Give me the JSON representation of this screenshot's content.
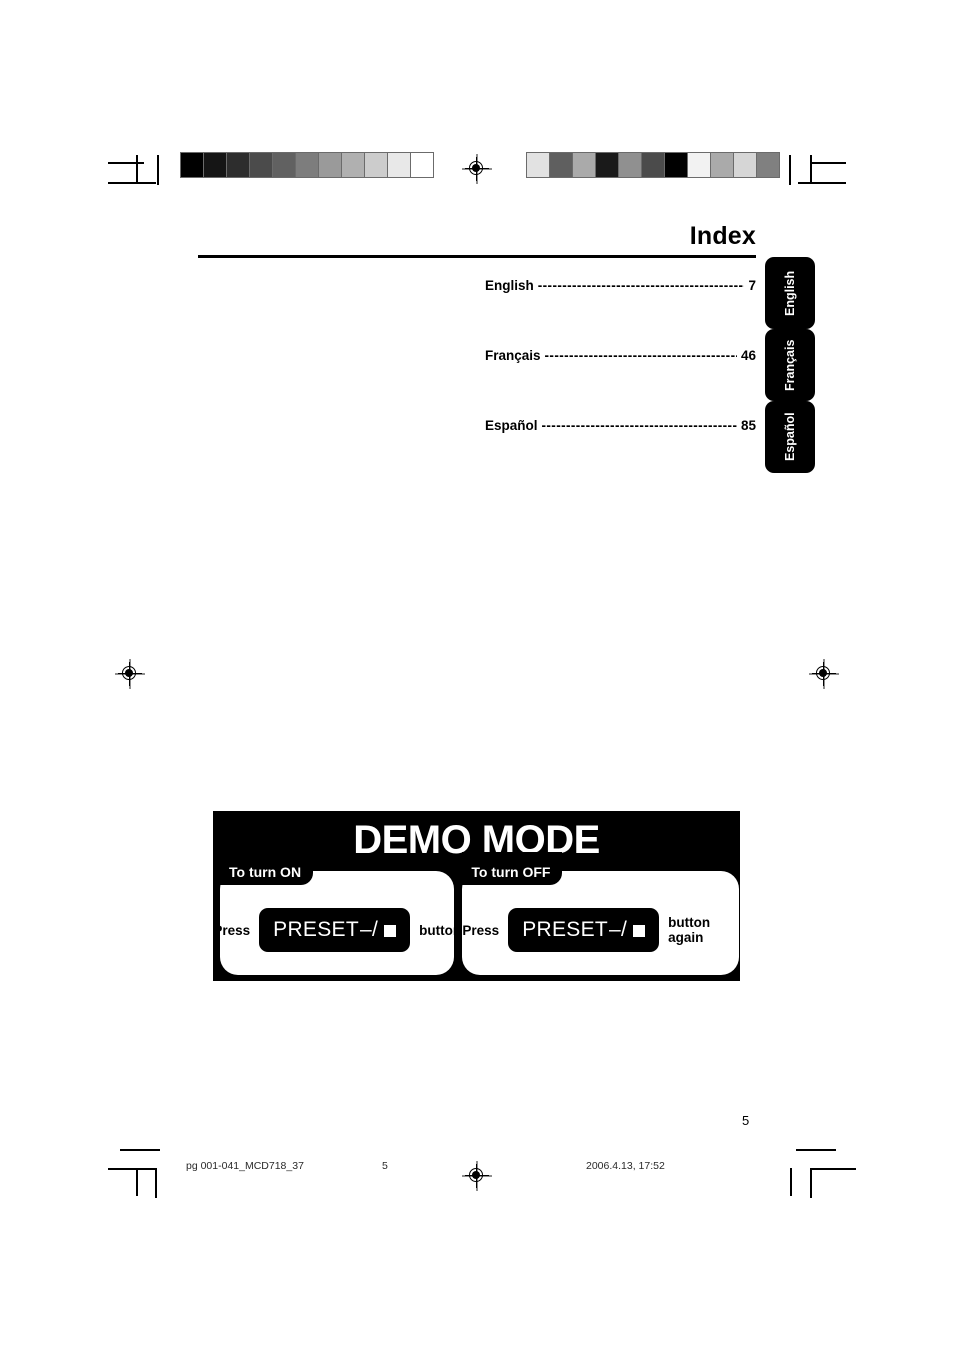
{
  "document": {
    "page_title": "Index",
    "page_number": "5"
  },
  "index": {
    "leader": "------------------------------------------------",
    "entries": [
      {
        "language": "English",
        "page": "7",
        "leader": "-----------------------------------------------"
      },
      {
        "language": "Français",
        "page": "46",
        "leader": "--------------------------------------------"
      },
      {
        "language": "Español",
        "page": "85",
        "leader": "---------------------------------------------"
      }
    ]
  },
  "side_tabs": [
    {
      "label": "English"
    },
    {
      "label": "Français"
    },
    {
      "label": "Español"
    }
  ],
  "demo_mode": {
    "title": "DEMO MODE",
    "cards": [
      {
        "tab_label": "To turn ON",
        "press_label": "Press",
        "key_label": "PRESET",
        "key_suffix": "–/",
        "key_icon": "stop-square-icon",
        "after_label": "button"
      },
      {
        "tab_label": "To turn OFF",
        "press_label": "Press",
        "key_label": "PRESET",
        "key_suffix": "–/",
        "key_icon": "stop-square-icon",
        "after_label": "button again"
      }
    ]
  },
  "footer": {
    "file_name": "pg 001-041_MCD718_37",
    "sheet_number": "5",
    "timestamp": "2006.4.13, 17:52"
  },
  "print_marks": {
    "grayscale_ramp": [
      "#000000",
      "#151515",
      "#2d2d2d",
      "#4b4b4b",
      "#616161",
      "#7d7d7d",
      "#9a9a9a",
      "#b0b0b0",
      "#cccccc",
      "#e8e8e8",
      "#ffffff"
    ],
    "grayscale_scramble": [
      "#e2e2e2",
      "#5f5f5f",
      "#aaaaaa",
      "#1a1a1a",
      "#909090",
      "#4b4b4b",
      "#000000",
      "#f2f2f2",
      "#aaaaaa",
      "#d6d6d6",
      "#808080"
    ]
  }
}
